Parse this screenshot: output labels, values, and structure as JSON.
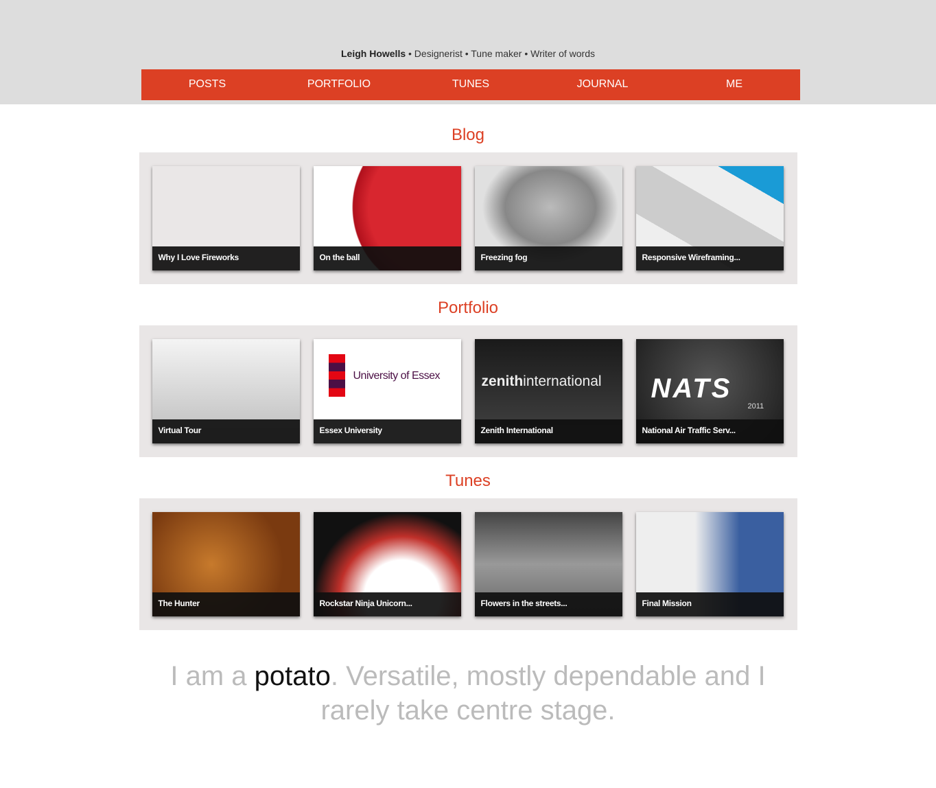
{
  "header": {
    "name": "Leigh Howells",
    "tagline": " • Designerist • Tune maker • Writer of words"
  },
  "nav": [
    "POSTS",
    "PORTFOLIO",
    "TUNES",
    "JOURNAL",
    "ME"
  ],
  "sections": [
    {
      "title": "Blog",
      "items": [
        "Why I Love Fireworks",
        "On the ball",
        "Freezing fog",
        "Responsive Wireframing..."
      ]
    },
    {
      "title": "Portfolio",
      "items": [
        "Virtual Tour",
        "Essex University",
        "Zenith International",
        "National Air Traffic Serv..."
      ]
    },
    {
      "title": "Tunes",
      "items": [
        "The Hunter",
        "Rockstar Ninja Unicorn...",
        "Flowers in the streets...",
        "Final Mission"
      ]
    }
  ],
  "logos": {
    "essex": "University of Essex",
    "zenith_a": "zenith",
    "zenith_b": "international",
    "nats": "NATS",
    "nats_year": "2011"
  },
  "quote": {
    "a": "I am a ",
    "b": "potato",
    "c": ". Versatile, mostly dependable and I rarely take centre stage."
  }
}
